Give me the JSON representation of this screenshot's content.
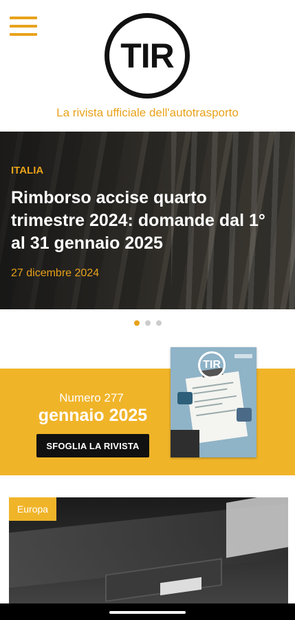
{
  "header": {
    "menu_icon": "hamburger-menu-icon",
    "logo_text": "TIR",
    "tagline": "La rivista ufficiale dell'autotrasporto"
  },
  "hero": {
    "category": "ITALIA",
    "title": "Rimborso accise quarto trimestre 2024: domande dal 1° al 31 gennaio 2025",
    "date": "27 dicembre 2024",
    "slides_total": 3,
    "active_slide": 1
  },
  "magazine": {
    "issue_number": "Numero 277",
    "month": "gennaio 2025",
    "button_label": "SFOGLIA LA RIVISTA",
    "cover_logo": "TIR"
  },
  "article_card": {
    "tag": "Europa"
  },
  "colors": {
    "accent": "#e8a21a",
    "band": "#f0b429",
    "dark": "#111111"
  }
}
